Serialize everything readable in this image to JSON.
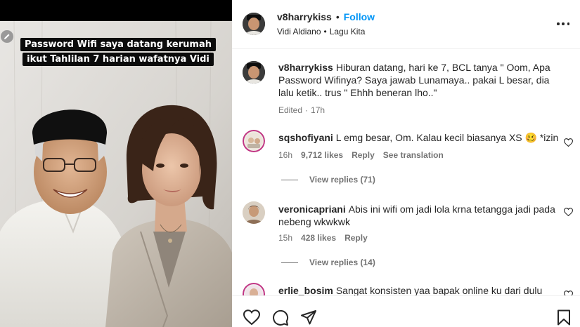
{
  "post": {
    "caption_lines": [
      "Password Wifi saya datang kerumah",
      "ikut Tahlilan 7 harian wafatnya Vidi"
    ]
  },
  "header": {
    "username": "v8harrykiss",
    "separator": "•",
    "follow_label": "Follow",
    "tagged_user": "Vidi Aldiano",
    "sub_separator": "•",
    "audio_title": "Lagu Kita"
  },
  "caption_comment": {
    "username": "v8harrykiss",
    "text": "Hiburan datang, hari ke 7, BCL tanya \" Oom, Apa Password Wifinya? Saya jawab Lunamaya.. pakai L besar, dia lalu ketik.. trus \" Ehhh beneran lho..\"",
    "edited": "Edited",
    "dot": "·",
    "time": "17h"
  },
  "comments": [
    {
      "username": "sqshofiyani",
      "text": "L emg besar, Om. Kalau kecil biasanya XS 🥴 *izin",
      "time": "16h",
      "likes": "9,712 likes",
      "reply_label": "Reply",
      "translate_label": "See translation",
      "view_replies": "View replies (71)"
    },
    {
      "username": "veronicapriani",
      "text": "Abis ini wifi om jadi lola krna tetangga jadi pada nebeng wkwkwk",
      "time": "15h",
      "likes": "428 likes",
      "reply_label": "Reply",
      "view_replies": "View replies (14)"
    },
    {
      "username": "erlie_bosim",
      "text": "Sangat konsisten yaa bapak online ku dari dulu"
    }
  ],
  "icons": {
    "more": "more-horizontal-icon",
    "like": "heart-icon",
    "comment": "comment-icon",
    "share": "paper-plane-icon",
    "save": "bookmark-icon",
    "edit": "pencil-icon"
  },
  "colors": {
    "link": "#0095f6",
    "text": "#262626",
    "secondary": "#737373"
  }
}
